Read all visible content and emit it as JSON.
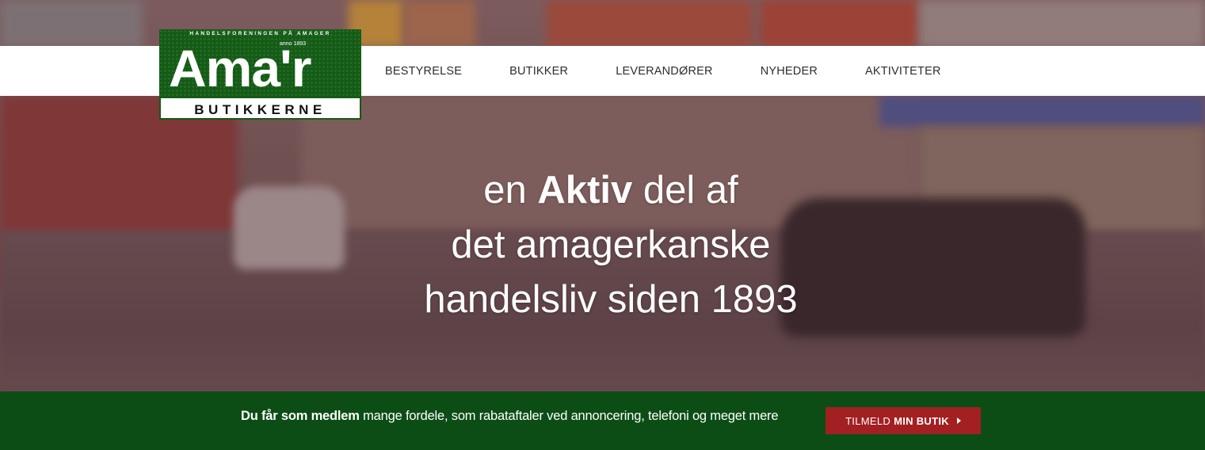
{
  "brand": {
    "top_text": "HANDELSFORENINGEN PÅ AMAGER",
    "anno": "anno 1893",
    "name": "Ama'r",
    "subtitle": "BUTIKKERNE",
    "green": "#145c16"
  },
  "nav": {
    "items": [
      {
        "label": "BESTYRELSE"
      },
      {
        "label": "BUTIKKER"
      },
      {
        "label": "LEVERANDØRER"
      },
      {
        "label": "NYHEDER"
      },
      {
        "label": "AKTIVITETER"
      }
    ]
  },
  "hero": {
    "line1_pre": "en ",
    "line1_bold": "Aktiv",
    "line1_post": " del af",
    "line2": "det amagerkanske",
    "line3": "handelsliv siden 1893"
  },
  "member_bar": {
    "bold_text": "Du får som medlem",
    "text": " mange fordele, som rabataftaler ved annoncering, telefoni og meget mere",
    "cta_pre": "TILMELD",
    "cta_bold": "MIN BUTIK",
    "cta_icon": "caret-right-icon",
    "bar_color": "#0c4d16",
    "cta_color": "#a32022"
  }
}
